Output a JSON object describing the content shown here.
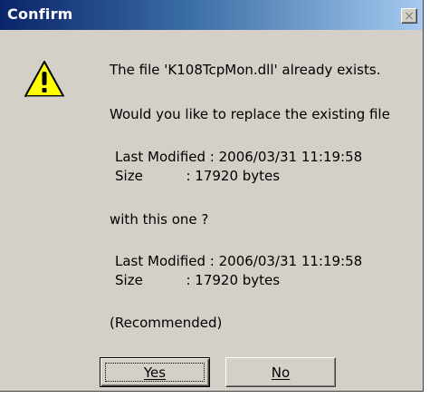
{
  "dialog": {
    "title": "Confirm",
    "close_label": "×",
    "icon": "warning-icon",
    "message_exists": "The file 'K108TcpMon.dll' already exists.",
    "message_replace": "Would you like to replace the existing file",
    "existing": {
      "modified": "Last Modified : 2006/03/31 11:19:58",
      "size": "Size          : 17920 bytes"
    },
    "with_this": "with this one ?",
    "new_file": {
      "modified": "Last Modified : 2006/03/31 11:19:58",
      "size": "Size          : 17920 bytes"
    },
    "recommended": "(Recommended)",
    "buttons": {
      "yes": "Yes",
      "no": "No"
    }
  }
}
